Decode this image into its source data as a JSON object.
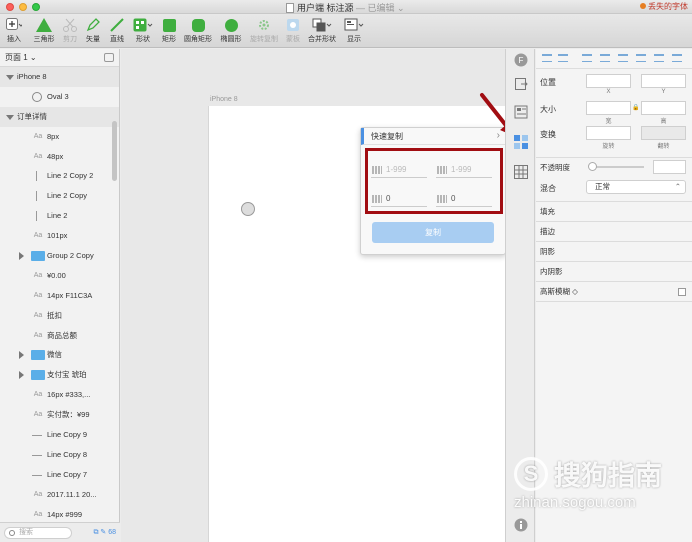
{
  "window": {
    "title": "用户端 标注源",
    "subtitle": "— 已编辑 ⌄",
    "missing_fonts": "丢失的字体"
  },
  "toolbar": {
    "insert": "插入",
    "triangle": "三角形",
    "scissors": "剪刀",
    "vector": "矢量",
    "line": "直线",
    "shapes": "形状",
    "rectangle": "矩形",
    "rounded_rect": "圆角矩形",
    "ellipse": "椭圆形",
    "rotate_copy": "旋转复制",
    "mask": "蒙板",
    "combine": "合并形状",
    "view": "显示",
    "accent": "#3fae3f"
  },
  "layers": {
    "page": "页面 1 ⌄",
    "items": [
      {
        "label": "iPhone 8",
        "kind": "artboard"
      },
      {
        "label": "Oval 3",
        "kind": "oval"
      },
      {
        "label": "订单详情",
        "kind": "artboard"
      },
      {
        "label": "8px",
        "kind": "text"
      },
      {
        "label": "48px",
        "kind": "text"
      },
      {
        "label": "Line 2 Copy 2",
        "kind": "vline"
      },
      {
        "label": "Line 2 Copy",
        "kind": "vline"
      },
      {
        "label": "Line 2",
        "kind": "vline"
      },
      {
        "label": "101px",
        "kind": "text"
      },
      {
        "label": "Group 2 Copy",
        "kind": "group"
      },
      {
        "label": "¥0.00",
        "kind": "text"
      },
      {
        "label": "14px F11C3A",
        "kind": "text"
      },
      {
        "label": "抵扣",
        "kind": "text"
      },
      {
        "label": "商品总额",
        "kind": "text"
      },
      {
        "label": "微信",
        "kind": "group"
      },
      {
        "label": "支付宝 琥珀",
        "kind": "group"
      },
      {
        "label": "16px #333,...",
        "kind": "text"
      },
      {
        "label": "实付款：¥99",
        "kind": "text"
      },
      {
        "label": "Line Copy 9",
        "kind": "hline"
      },
      {
        "label": "Line Copy 8",
        "kind": "hline"
      },
      {
        "label": "Line Copy 7",
        "kind": "hline"
      },
      {
        "label": "2017.11.1 20...",
        "kind": "text"
      },
      {
        "label": "14px #999",
        "kind": "text"
      }
    ],
    "text_glyph": "Aa",
    "search_placeholder": "搜索",
    "count": "68"
  },
  "canvas": {
    "artboard_label": "iPhone 8"
  },
  "popup": {
    "title": "快速复制",
    "rows_placeholder": "1-999",
    "cols_placeholder": "1-999",
    "vspacing": "0",
    "hspacing": "0",
    "copy_button": "复制",
    "highlight_color": "#a10d12"
  },
  "inspector": {
    "position": "位置",
    "x": "X",
    "y": "Y",
    "size": "大小",
    "width": "宽",
    "height": "高",
    "transform": "变换",
    "rotate": "旋转",
    "flip": "翻转",
    "opacity": "不透明度",
    "blend": "混合",
    "blend_value": "正常",
    "fill": "填充",
    "border": "描边",
    "shadow": "阴影",
    "inner_shadow": "内阴影",
    "gaussian_blur": "高斯模糊 ◇"
  },
  "watermark": {
    "brand": "搜狗指南",
    "url": "zhinan.sogou.com"
  }
}
